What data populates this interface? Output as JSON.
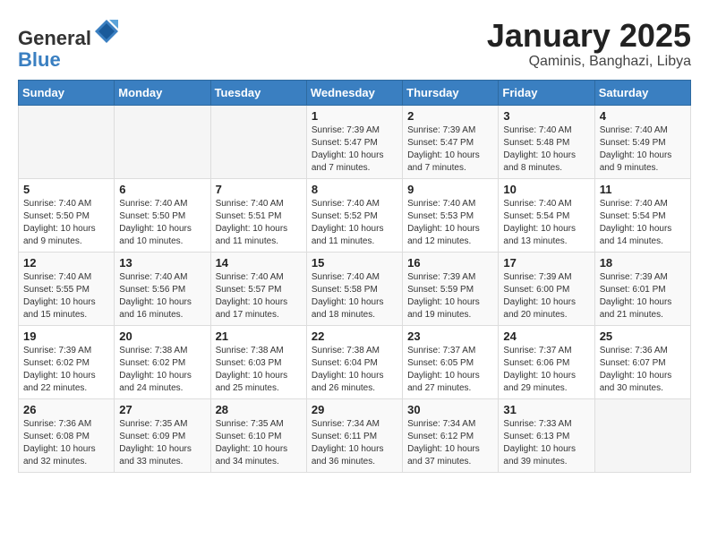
{
  "logo": {
    "general": "General",
    "blue": "Blue"
  },
  "header": {
    "month": "January 2025",
    "location": "Qaminis, Banghazi, Libya"
  },
  "weekdays": [
    "Sunday",
    "Monday",
    "Tuesday",
    "Wednesday",
    "Thursday",
    "Friday",
    "Saturday"
  ],
  "weeks": [
    [
      {
        "day": "",
        "info": ""
      },
      {
        "day": "",
        "info": ""
      },
      {
        "day": "",
        "info": ""
      },
      {
        "day": "1",
        "info": "Sunrise: 7:39 AM\nSunset: 5:47 PM\nDaylight: 10 hours\nand 7 minutes."
      },
      {
        "day": "2",
        "info": "Sunrise: 7:39 AM\nSunset: 5:47 PM\nDaylight: 10 hours\nand 7 minutes."
      },
      {
        "day": "3",
        "info": "Sunrise: 7:40 AM\nSunset: 5:48 PM\nDaylight: 10 hours\nand 8 minutes."
      },
      {
        "day": "4",
        "info": "Sunrise: 7:40 AM\nSunset: 5:49 PM\nDaylight: 10 hours\nand 9 minutes."
      }
    ],
    [
      {
        "day": "5",
        "info": "Sunrise: 7:40 AM\nSunset: 5:50 PM\nDaylight: 10 hours\nand 9 minutes."
      },
      {
        "day": "6",
        "info": "Sunrise: 7:40 AM\nSunset: 5:50 PM\nDaylight: 10 hours\nand 10 minutes."
      },
      {
        "day": "7",
        "info": "Sunrise: 7:40 AM\nSunset: 5:51 PM\nDaylight: 10 hours\nand 11 minutes."
      },
      {
        "day": "8",
        "info": "Sunrise: 7:40 AM\nSunset: 5:52 PM\nDaylight: 10 hours\nand 11 minutes."
      },
      {
        "day": "9",
        "info": "Sunrise: 7:40 AM\nSunset: 5:53 PM\nDaylight: 10 hours\nand 12 minutes."
      },
      {
        "day": "10",
        "info": "Sunrise: 7:40 AM\nSunset: 5:54 PM\nDaylight: 10 hours\nand 13 minutes."
      },
      {
        "day": "11",
        "info": "Sunrise: 7:40 AM\nSunset: 5:54 PM\nDaylight: 10 hours\nand 14 minutes."
      }
    ],
    [
      {
        "day": "12",
        "info": "Sunrise: 7:40 AM\nSunset: 5:55 PM\nDaylight: 10 hours\nand 15 minutes."
      },
      {
        "day": "13",
        "info": "Sunrise: 7:40 AM\nSunset: 5:56 PM\nDaylight: 10 hours\nand 16 minutes."
      },
      {
        "day": "14",
        "info": "Sunrise: 7:40 AM\nSunset: 5:57 PM\nDaylight: 10 hours\nand 17 minutes."
      },
      {
        "day": "15",
        "info": "Sunrise: 7:40 AM\nSunset: 5:58 PM\nDaylight: 10 hours\nand 18 minutes."
      },
      {
        "day": "16",
        "info": "Sunrise: 7:39 AM\nSunset: 5:59 PM\nDaylight: 10 hours\nand 19 minutes."
      },
      {
        "day": "17",
        "info": "Sunrise: 7:39 AM\nSunset: 6:00 PM\nDaylight: 10 hours\nand 20 minutes."
      },
      {
        "day": "18",
        "info": "Sunrise: 7:39 AM\nSunset: 6:01 PM\nDaylight: 10 hours\nand 21 minutes."
      }
    ],
    [
      {
        "day": "19",
        "info": "Sunrise: 7:39 AM\nSunset: 6:02 PM\nDaylight: 10 hours\nand 22 minutes."
      },
      {
        "day": "20",
        "info": "Sunrise: 7:38 AM\nSunset: 6:02 PM\nDaylight: 10 hours\nand 24 minutes."
      },
      {
        "day": "21",
        "info": "Sunrise: 7:38 AM\nSunset: 6:03 PM\nDaylight: 10 hours\nand 25 minutes."
      },
      {
        "day": "22",
        "info": "Sunrise: 7:38 AM\nSunset: 6:04 PM\nDaylight: 10 hours\nand 26 minutes."
      },
      {
        "day": "23",
        "info": "Sunrise: 7:37 AM\nSunset: 6:05 PM\nDaylight: 10 hours\nand 27 minutes."
      },
      {
        "day": "24",
        "info": "Sunrise: 7:37 AM\nSunset: 6:06 PM\nDaylight: 10 hours\nand 29 minutes."
      },
      {
        "day": "25",
        "info": "Sunrise: 7:36 AM\nSunset: 6:07 PM\nDaylight: 10 hours\nand 30 minutes."
      }
    ],
    [
      {
        "day": "26",
        "info": "Sunrise: 7:36 AM\nSunset: 6:08 PM\nDaylight: 10 hours\nand 32 minutes."
      },
      {
        "day": "27",
        "info": "Sunrise: 7:35 AM\nSunset: 6:09 PM\nDaylight: 10 hours\nand 33 minutes."
      },
      {
        "day": "28",
        "info": "Sunrise: 7:35 AM\nSunset: 6:10 PM\nDaylight: 10 hours\nand 34 minutes."
      },
      {
        "day": "29",
        "info": "Sunrise: 7:34 AM\nSunset: 6:11 PM\nDaylight: 10 hours\nand 36 minutes."
      },
      {
        "day": "30",
        "info": "Sunrise: 7:34 AM\nSunset: 6:12 PM\nDaylight: 10 hours\nand 37 minutes."
      },
      {
        "day": "31",
        "info": "Sunrise: 7:33 AM\nSunset: 6:13 PM\nDaylight: 10 hours\nand 39 minutes."
      },
      {
        "day": "",
        "info": ""
      }
    ]
  ]
}
